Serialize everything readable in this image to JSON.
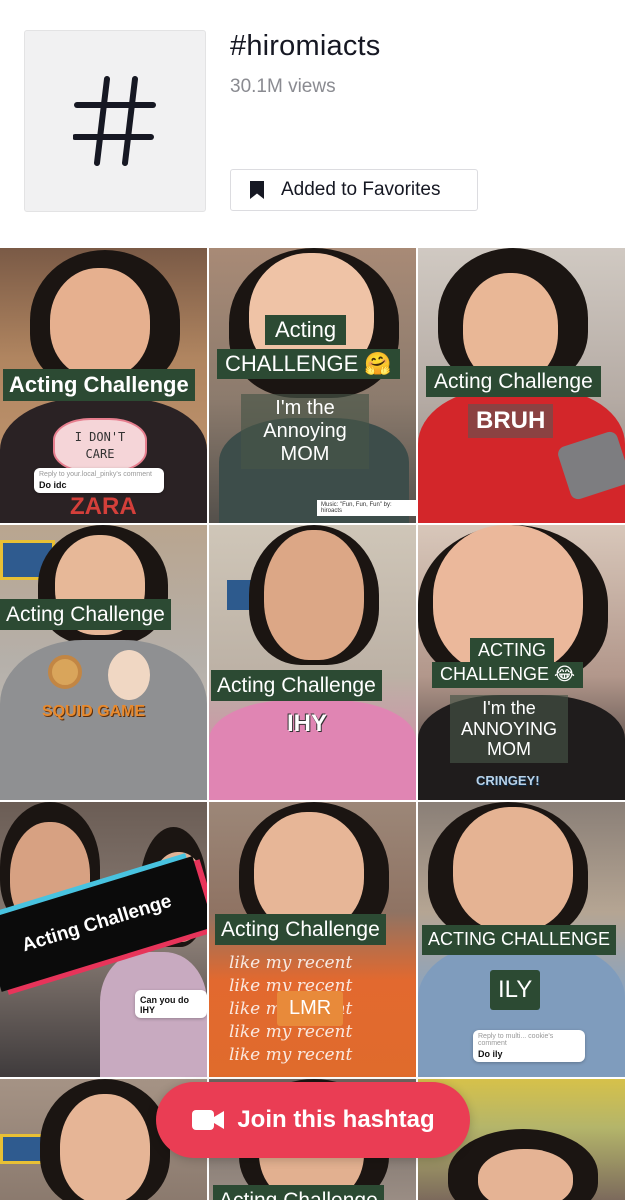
{
  "header": {
    "hashtag_title": "#hiromiacts",
    "views": "30.1M views",
    "favorite_label": "Added to Favorites",
    "thumb_icon": "hashtag-icon"
  },
  "videos": [
    {
      "caption": "Acting Challenge",
      "overlay_text": "I DON'T CARE",
      "reply_header": "Reply to your.local_pinky's comment",
      "reply_text": "Do idc"
    },
    {
      "caption_line1": "Acting",
      "caption_line2": "CHALLENGE 🤗",
      "overlay_text": "I'm the Annoying MOM",
      "music": "Music: \"Fun, Fun, Fun\" by: hiroacts"
    },
    {
      "caption": "Acting Challenge",
      "overlay_text": "BRUH"
    },
    {
      "caption": "Acting Challenge",
      "overlay_text": "SQUID GAME"
    },
    {
      "caption": "Acting Challenge",
      "overlay_text": "IHY"
    },
    {
      "caption_line1": "ACTING",
      "caption_line2": "CHALLENGE 😂",
      "overlay_text": "I'm the ANNOYING MOM",
      "overlay_text2": "CRINGEY!"
    },
    {
      "caption": "Acting Challenge",
      "reply_text": "Can you do IHY"
    },
    {
      "caption": "Acting Challenge",
      "overlay_text": "LMR",
      "bg_text": "like my recent"
    },
    {
      "caption": "ACTING CHALLENGE",
      "overlay_text": "ILY",
      "reply_header": "Reply to multi... cookie's comment",
      "reply_text": "Do ily"
    },
    {
      "caption": ""
    },
    {
      "caption": "Acting Challenge"
    },
    {
      "caption": ""
    }
  ],
  "join_button": {
    "label": "Join this hashtag",
    "icon": "video-camera-icon"
  },
  "colors": {
    "accent": "#ea3d54",
    "caption_bg": "#2c4a33",
    "text_primary": "#161823",
    "text_secondary": "#8a8b91"
  }
}
